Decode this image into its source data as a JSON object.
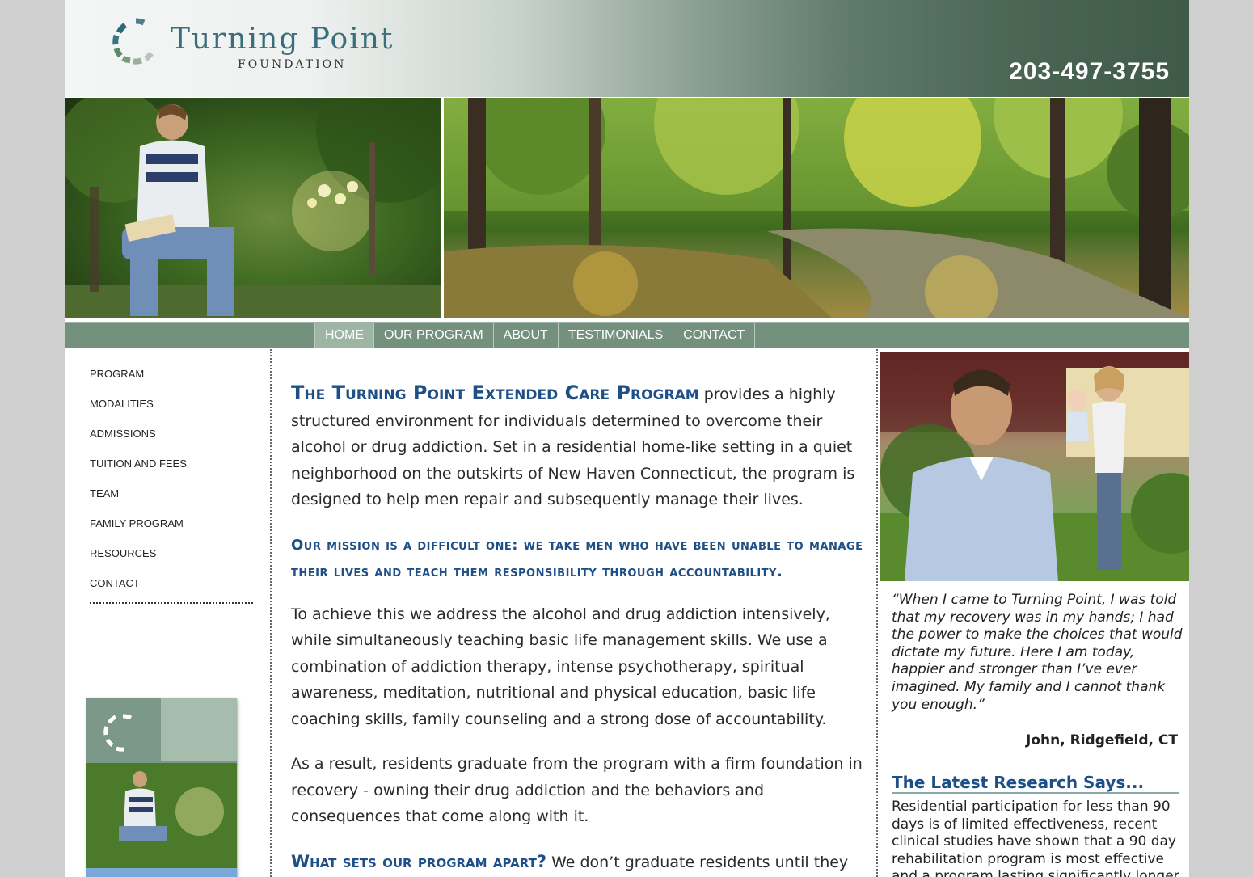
{
  "header": {
    "logo_name": "Turning Point",
    "logo_sub": "FOUNDATION",
    "phone": "203-497-3755"
  },
  "nav": {
    "items": [
      {
        "label": "HOME",
        "active": true
      },
      {
        "label": "OUR PROGRAM",
        "active": false
      },
      {
        "label": "ABOUT",
        "active": false
      },
      {
        "label": "TESTIMONIALS",
        "active": false
      },
      {
        "label": "CONTACT",
        "active": false
      }
    ]
  },
  "sidebar": {
    "items": [
      {
        "label": "PROGRAM"
      },
      {
        "label": "MODALITIES"
      },
      {
        "label": "ADMISSIONS"
      },
      {
        "label": "TUITION AND FEES"
      },
      {
        "label": "TEAM"
      },
      {
        "label": "FAMILY PROGRAM"
      },
      {
        "label": "RESOURCES"
      },
      {
        "label": "CONTACT"
      }
    ]
  },
  "main": {
    "intro_title": "The Turning Point Extended Care Program",
    "intro_text": " provides a highly structured environment for individuals determined to overcome their alcohol or drug addiction. Set in a residential home-like setting in a quiet neighborhood on the outskirts of New Haven Connecticut, the program is designed to help men repair and subsequently manage their lives.",
    "mission": "Our mission is a difficult one: we take men who have been unable to manage their lives and teach them responsibility through accountability.",
    "para2": "To achieve this we address the alcohol and drug addiction intensively, while simultaneously teaching basic life management skills. We use a combination of addiction therapy, intense psychotherapy, spiritual awareness, meditation, nutritional and physical education, basic life coaching skills, family counseling and a strong dose of accountability.",
    "para3": "As a result, residents graduate from the program with a firm foundation in recovery - owning their drug addiction and the behaviors and consequences that come along with it.",
    "apart_title": "What sets our program apart?",
    "apart_text": " We don’t graduate residents until they are"
  },
  "right": {
    "quote": "“When I came to Turning Point, I was told that my recovery was in my hands; I had the power to make the choices that would dictate my future. Here I am today, happier and stronger than I’ve ever imagined. My family and I cannot thank you enough.”",
    "author": "John, Ridgefield, CT",
    "research_title": "The Latest Research Says...",
    "research_text": "Residential participation for less than 90 days is of limited effectiveness, recent clinical studies have shown that a 90 day rehabilitation program is most effective and a program lasting significantly longer"
  },
  "colors": {
    "accent": "#1e4f86",
    "nav_bg": "#74917d",
    "nav_active": "#9cb5a4",
    "logo_teal": "#3b6e7d"
  }
}
